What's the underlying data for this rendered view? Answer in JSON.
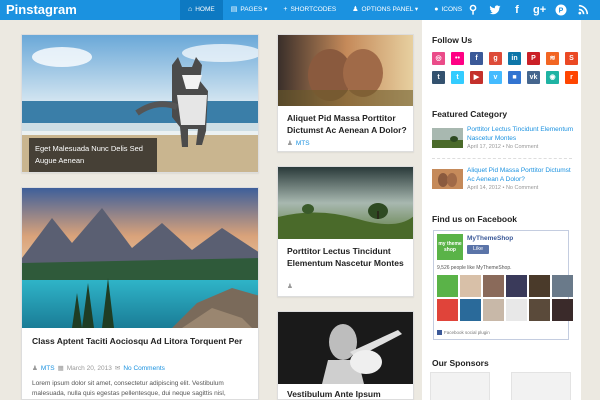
{
  "header": {
    "logo": "Pinstagram",
    "nav": [
      {
        "icon": "home-icon",
        "glyph": "⌂",
        "label": "Home"
      },
      {
        "icon": "pages-icon",
        "glyph": "▤",
        "label": "Pages ▾"
      },
      {
        "icon": "plus-icon",
        "glyph": "+",
        "label": "Shortcodes"
      },
      {
        "icon": "user-icon",
        "glyph": "♟",
        "label": "Options Panel ▾"
      },
      {
        "icon": "apple-icon",
        "glyph": "●",
        "label": "Icons"
      }
    ],
    "social": [
      {
        "name": "search-icon",
        "glyph": "⚲"
      },
      {
        "name": "twitter-icon",
        "glyph": "🐦"
      },
      {
        "name": "facebook-icon",
        "glyph": "f"
      },
      {
        "name": "google-plus-icon",
        "glyph": "g+"
      },
      {
        "name": "pinterest-icon",
        "glyph": "P"
      },
      {
        "name": "rss-icon",
        "glyph": "≋"
      }
    ]
  },
  "posts": {
    "husky": {
      "caption": "Eget Malesuada Nunc Delis Sed Augue Aenean"
    },
    "lake": {
      "title": "Class Aptent Taciti Aociosqu Ad Litora Torquent Per",
      "author": "MTS",
      "date": "March 20, 2013",
      "comments": "No Comments",
      "excerpt": "Lorem ipsum dolor sit amet, consectetur adipiscing elit. Vestibulum malesuada, nulla quis egestas pellentesque, dui neque sagittis nisl,"
    },
    "kiss": {
      "title": "Aliquet Pid Massa Porttitor Dictumst Ac Aenean A Dolor?",
      "author": "MTS"
    },
    "field": {
      "title": "Porttitor Lectus Tincidunt Elementum Nascetur Montes"
    },
    "guitar": {
      "title": "Vestibulum Ante Ipsum"
    }
  },
  "sidebar": {
    "follow_title": "Follow Us",
    "follow_icons": [
      {
        "name": "dribbble-icon",
        "color": "#ea4c89",
        "glyph": "◎"
      },
      {
        "name": "flickr-icon",
        "color": "#ff0084",
        "glyph": "••"
      },
      {
        "name": "facebook-icon",
        "color": "#3b5998",
        "glyph": "f"
      },
      {
        "name": "google-plus-icon",
        "color": "#dd4b39",
        "glyph": "g"
      },
      {
        "name": "linkedin-icon",
        "color": "#0e76a8",
        "glyph": "in"
      },
      {
        "name": "pinterest-icon",
        "color": "#cb2027",
        "glyph": "P"
      },
      {
        "name": "rss-icon",
        "color": "#f26522",
        "glyph": "≋"
      },
      {
        "name": "stumbleupon-icon",
        "color": "#eb4924",
        "glyph": "S"
      },
      {
        "name": "tumblr-icon",
        "color": "#34526f",
        "glyph": "t"
      },
      {
        "name": "twitter-icon",
        "color": "#33ccff",
        "glyph": "t"
      },
      {
        "name": "youtube-icon",
        "color": "#c4302b",
        "glyph": "▶"
      },
      {
        "name": "vimeo-icon",
        "color": "#44bbff",
        "glyph": "v"
      },
      {
        "name": "delicious-icon",
        "color": "#3274d1",
        "glyph": "■"
      },
      {
        "name": "vk-icon",
        "color": "#45668e",
        "glyph": "vk"
      },
      {
        "name": "weibo-icon",
        "color": "#1fb3a3",
        "glyph": "◉"
      },
      {
        "name": "reddit-icon",
        "color": "#ff4500",
        "glyph": "r"
      }
    ],
    "featured_title": "Featured Category",
    "featured": [
      {
        "title": "Porttitor Lectus Tincidunt Elementum Nascetur Montes",
        "date": "April 17, 2012",
        "comments": "No Comment"
      },
      {
        "title": "Aliquet Pid Massa Porttitor Dictumst Ac Aenean A Dolor?",
        "date": "April 14, 2012",
        "comments": "No Comment"
      }
    ],
    "facebook_title": "Find us on Facebook",
    "facebook": {
      "logo": "my theme shop",
      "page_name": "MyThemeShop",
      "like_label": "Like",
      "likes_text": "9,526 people like MyThemeShop.",
      "plugin_label": "Facebook social plugin"
    },
    "sponsors_title": "Our Sponsors"
  }
}
